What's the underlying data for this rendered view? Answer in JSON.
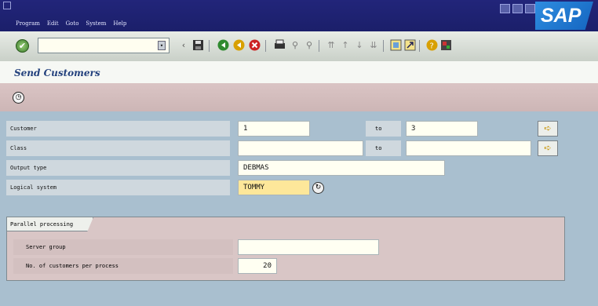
{
  "menu": [
    "Program",
    "Edit",
    "Goto",
    "System",
    "Help"
  ],
  "logo": "SAP",
  "screen_title": "Send Customers",
  "fields": {
    "customer": {
      "label": "Customer",
      "from": "1",
      "to_label": "to",
      "to": "3"
    },
    "class": {
      "label": "Class",
      "from": "",
      "to_label": "to",
      "to": ""
    },
    "output_type": {
      "label": "Output type",
      "value": "DEBMAS"
    },
    "logical_system": {
      "label": "Logical system",
      "value": "TOMMY"
    }
  },
  "parallel": {
    "title": "Parallel processing",
    "server_group": {
      "label": "Server group",
      "value": ""
    },
    "customers_per_process": {
      "label": "No. of customers per process",
      "value": "20"
    }
  },
  "icons": {
    "ok": "check-icon",
    "save": "save-icon",
    "back": "back-icon",
    "exit": "exit-icon",
    "cancel": "cancel-icon",
    "print": "print-icon",
    "find": "find-icon",
    "find_next": "find-next-icon",
    "first_page": "first-page-icon",
    "prev_page": "prev-page-icon",
    "next_page": "next-page-icon",
    "last_page": "last-page-icon",
    "new_session": "new-session-icon",
    "shortcut": "shortcut-icon",
    "help": "help-icon",
    "layout": "layout-icon",
    "execute": "execute-clock-icon",
    "multiple_selection": "arrow-right-icon",
    "possible_entries": "possible-entries-icon"
  },
  "colors": {
    "title_bar": "#1b1f6a",
    "background": "#a9bfcf",
    "group_box": "#d9c6c6",
    "highlight_field": "#fde79a"
  }
}
